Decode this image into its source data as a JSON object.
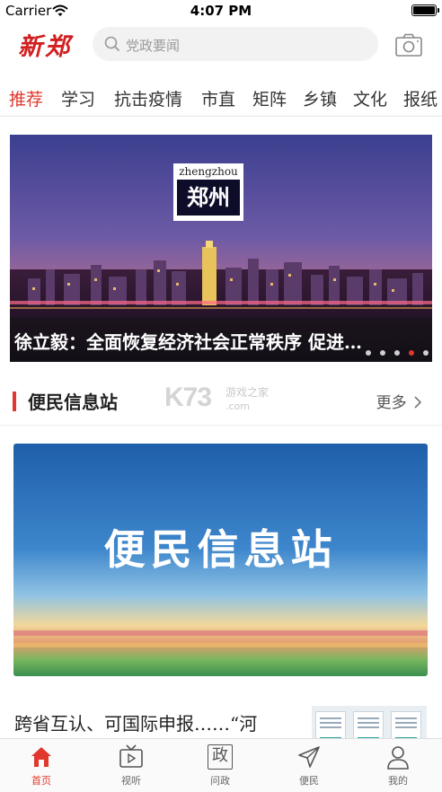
{
  "status_bar": {
    "carrier": "Carrier",
    "time": "4:07 PM"
  },
  "header": {
    "logo_text": "新郑",
    "search_placeholder": "党政要闻"
  },
  "category_tabs": [
    {
      "label": "推荐",
      "active": true
    },
    {
      "label": "学习",
      "active": false
    },
    {
      "label": "抗击疫情",
      "active": false
    },
    {
      "label": "市直",
      "active": false
    },
    {
      "label": "矩阵",
      "active": false
    },
    {
      "label": "乡镇",
      "active": false
    },
    {
      "label": "文化",
      "active": false
    },
    {
      "label": "报纸",
      "active": false
    }
  ],
  "banner": {
    "badge_latin": "zhengzhou",
    "badge_chinese": "郑州",
    "title": "徐立毅：全面恢复经济社会正常秩序 促进…",
    "slide_count": 5,
    "active_slide": 4
  },
  "section": {
    "title": "便民信息站",
    "more_label": "更多"
  },
  "watermark": {
    "big": "K73",
    "line1": "游戏之家",
    "line2": ".com"
  },
  "info_card": {
    "title": "便民信息站"
  },
  "news": [
    {
      "title": "跨省互认、可国际申报……“河"
    }
  ],
  "tabbar": [
    {
      "label": "首页",
      "icon": "home-icon",
      "active": true
    },
    {
      "label": "视听",
      "icon": "tv-icon",
      "active": false
    },
    {
      "label": "问政",
      "icon": "zheng-icon",
      "active": false
    },
    {
      "label": "便民",
      "icon": "send-icon",
      "active": false
    },
    {
      "label": "我的",
      "icon": "user-icon",
      "active": false
    }
  ],
  "tabbar_zheng_glyph": "政",
  "colors": {
    "accent": "#e0382c",
    "logo": "#d21f1f"
  }
}
